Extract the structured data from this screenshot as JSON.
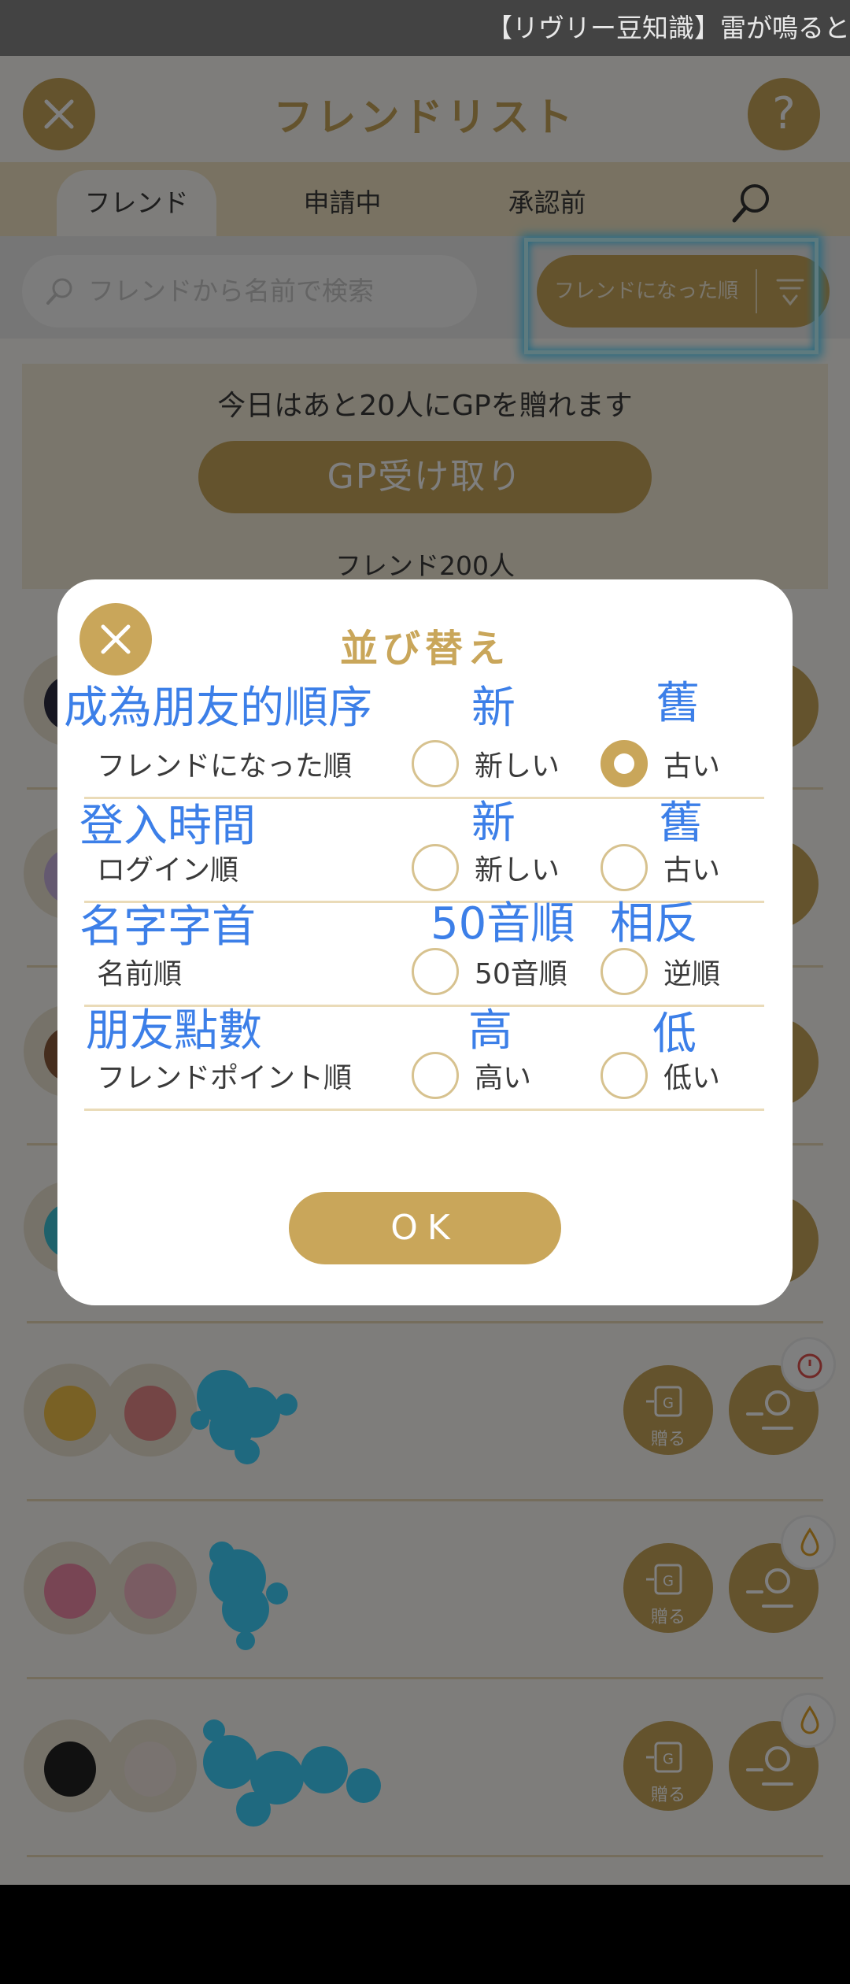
{
  "ticker": {
    "text": "【リヴリー豆知識】雷が鳴ると"
  },
  "header": {
    "title": "フレンドリスト",
    "help_label": "?"
  },
  "tabs": [
    {
      "label": "フレンド"
    },
    {
      "label": "申請中"
    },
    {
      "label": "承認前"
    }
  ],
  "search": {
    "placeholder": "フレンドから名前で検索"
  },
  "sort_button": {
    "label": "フレンドになった順"
  },
  "info": {
    "gp_text": "今日はあと20人にGPを贈れます",
    "gp_button": "GP受け取り",
    "friend_count": "フレンド200人"
  },
  "friend_rows": [
    {
      "gift_label": "贈る",
      "badge": "timer-icon"
    },
    {
      "gift_label": "贈る",
      "badge": "drop-icon"
    },
    {
      "gift_label": "贈る",
      "badge": "drop-icon"
    }
  ],
  "modal": {
    "title": "並び替え",
    "ok_label": "OK",
    "sections": [
      {
        "note": "成為朋友的順序",
        "label": "フレンドになった順",
        "option_a": "新しい",
        "note_a": "新",
        "option_b": "古い",
        "note_b": "舊",
        "selected": "b"
      },
      {
        "note": "登入時間",
        "label": "ログイン順",
        "option_a": "新しい",
        "note_a": "新",
        "option_b": "古い",
        "note_b": "舊",
        "selected": "none"
      },
      {
        "note": "名字字首",
        "label": "名前順",
        "option_a": "50音順",
        "note_a": "50音順",
        "option_b": "逆順",
        "note_b": "相反",
        "selected": "none"
      },
      {
        "note": "朋友點數",
        "label": "フレンドポイント順",
        "option_a": "高い",
        "note_a": "高",
        "option_b": "低い",
        "note_b": "低",
        "selected": "none"
      }
    ]
  },
  "colors": {
    "accent": "#c9a65a",
    "note": "#3c7fe8",
    "highlight": "#4fd3ff"
  }
}
